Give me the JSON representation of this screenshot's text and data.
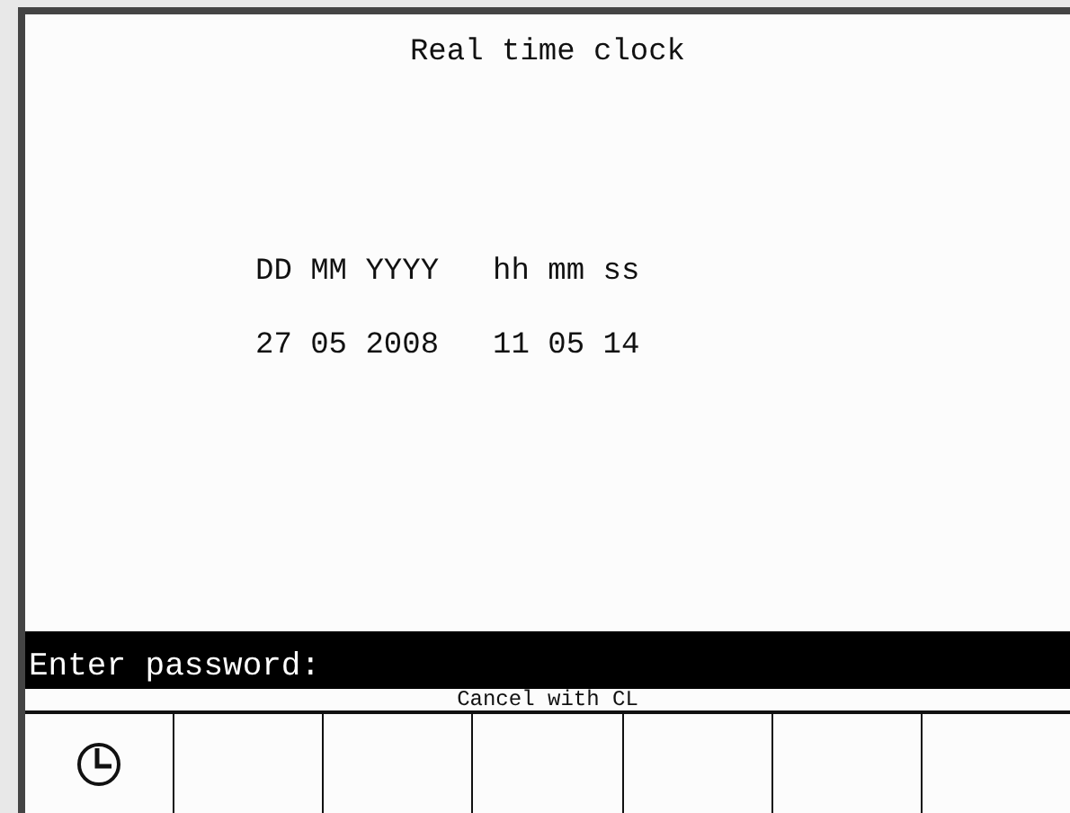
{
  "title": "Real time clock",
  "fields": [
    {
      "label": "DD MM YYYY",
      "value": "27 05 2008"
    },
    {
      "label": "hh mm ss",
      "value": "11 05 14"
    }
  ],
  "prompt": "Enter password:",
  "hint": "Cancel with CL",
  "softkeys": [
    {
      "kind": "icon"
    },
    {
      "kind": "blank"
    },
    {
      "kind": "blank"
    },
    {
      "kind": "blank"
    },
    {
      "kind": "blank"
    },
    {
      "kind": "blank"
    },
    {
      "kind": "blank"
    }
  ]
}
